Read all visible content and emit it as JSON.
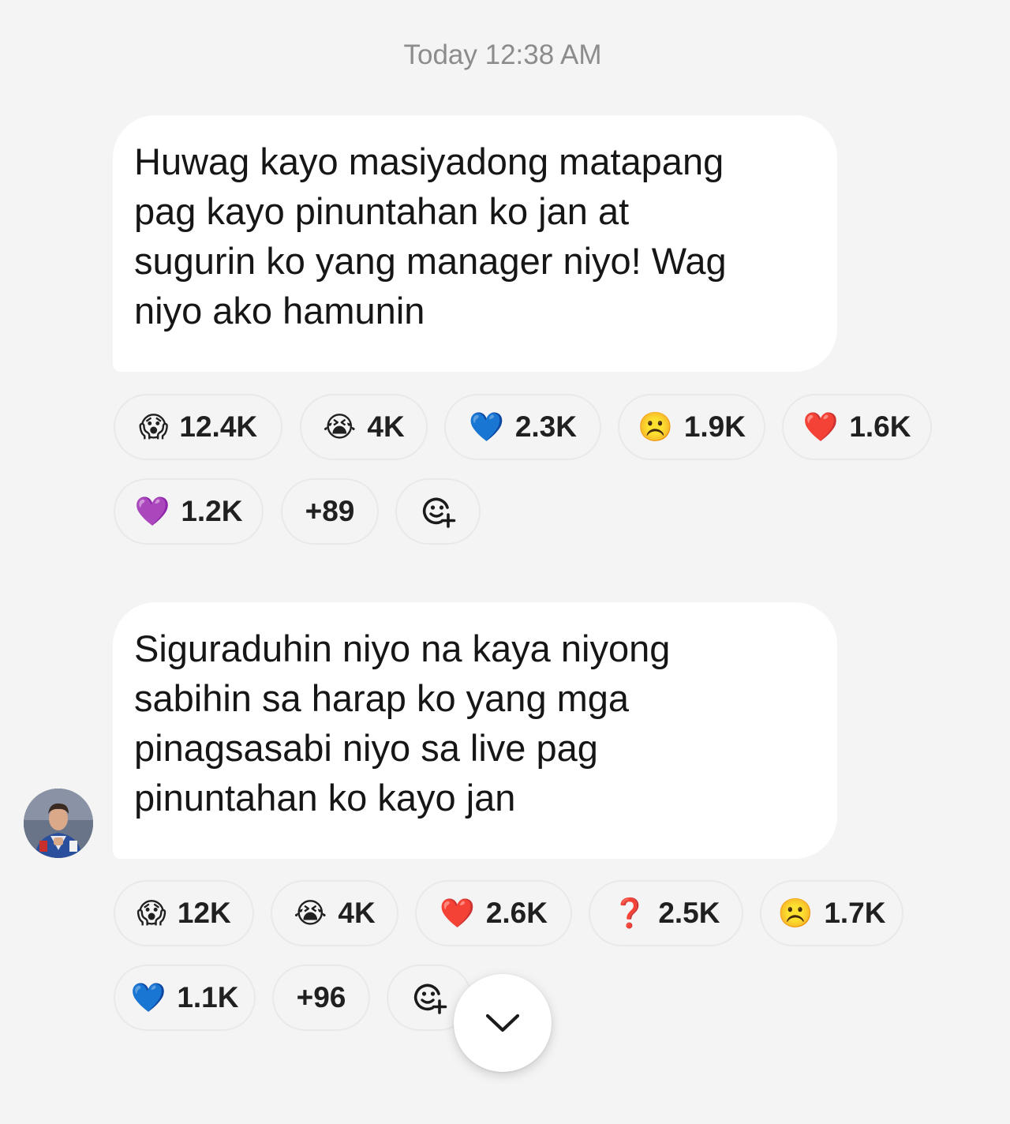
{
  "timestamp": "Today 12:38 AM",
  "messages": [
    {
      "lines": [
        "Huwag kayo masiyadong matapang",
        "pag kayo pinuntahan ko jan at",
        "sugurin ko yang manager niyo! Wag",
        "niyo ako hamunin"
      ],
      "reactions": [
        {
          "emoji": "😱",
          "icon": "screaming-face-icon",
          "count": "12.4K"
        },
        {
          "emoji": "😭",
          "icon": "crying-face-icon",
          "count": "4K"
        },
        {
          "emoji": "💙",
          "icon": "blue-heart-icon",
          "count": "2.3K"
        },
        {
          "emoji": "☹️",
          "icon": "frowning-face-icon",
          "count": "1.9K"
        },
        {
          "emoji": "❤️",
          "icon": "red-heart-icon",
          "count": "1.6K"
        },
        {
          "emoji": "💜",
          "icon": "purple-heart-icon",
          "count": "1.2K"
        }
      ],
      "more": "+89"
    },
    {
      "lines": [
        "Siguraduhin niyo na kaya niyong",
        "sabihin sa harap ko yang mga",
        "pinagsasabi niyo sa live pag",
        "pinuntahan ko kayo jan"
      ],
      "reactions": [
        {
          "emoji": "😱",
          "icon": "screaming-face-icon",
          "count": "12K"
        },
        {
          "emoji": "😭",
          "icon": "crying-face-icon",
          "count": "4K"
        },
        {
          "emoji": "❤️",
          "icon": "red-heart-icon",
          "count": "2.6K"
        },
        {
          "emoji": "❓",
          "icon": "question-mark-icon",
          "count": "2.5K"
        },
        {
          "emoji": "☹️",
          "icon": "frowning-face-icon",
          "count": "1.7K"
        },
        {
          "emoji": "💙",
          "icon": "blue-heart-icon",
          "count": "1.1K"
        }
      ],
      "more": "+96"
    }
  ],
  "colors": {
    "background": "#f4f4f4",
    "bubble": "#ffffff",
    "text": "#161616",
    "timestamp": "#8c8c8c",
    "pill_border": "#e9e9e9"
  },
  "icons": {
    "add_reaction": "add-reaction-icon",
    "scroll_down": "chevron-down-icon",
    "avatar": "avatar"
  }
}
